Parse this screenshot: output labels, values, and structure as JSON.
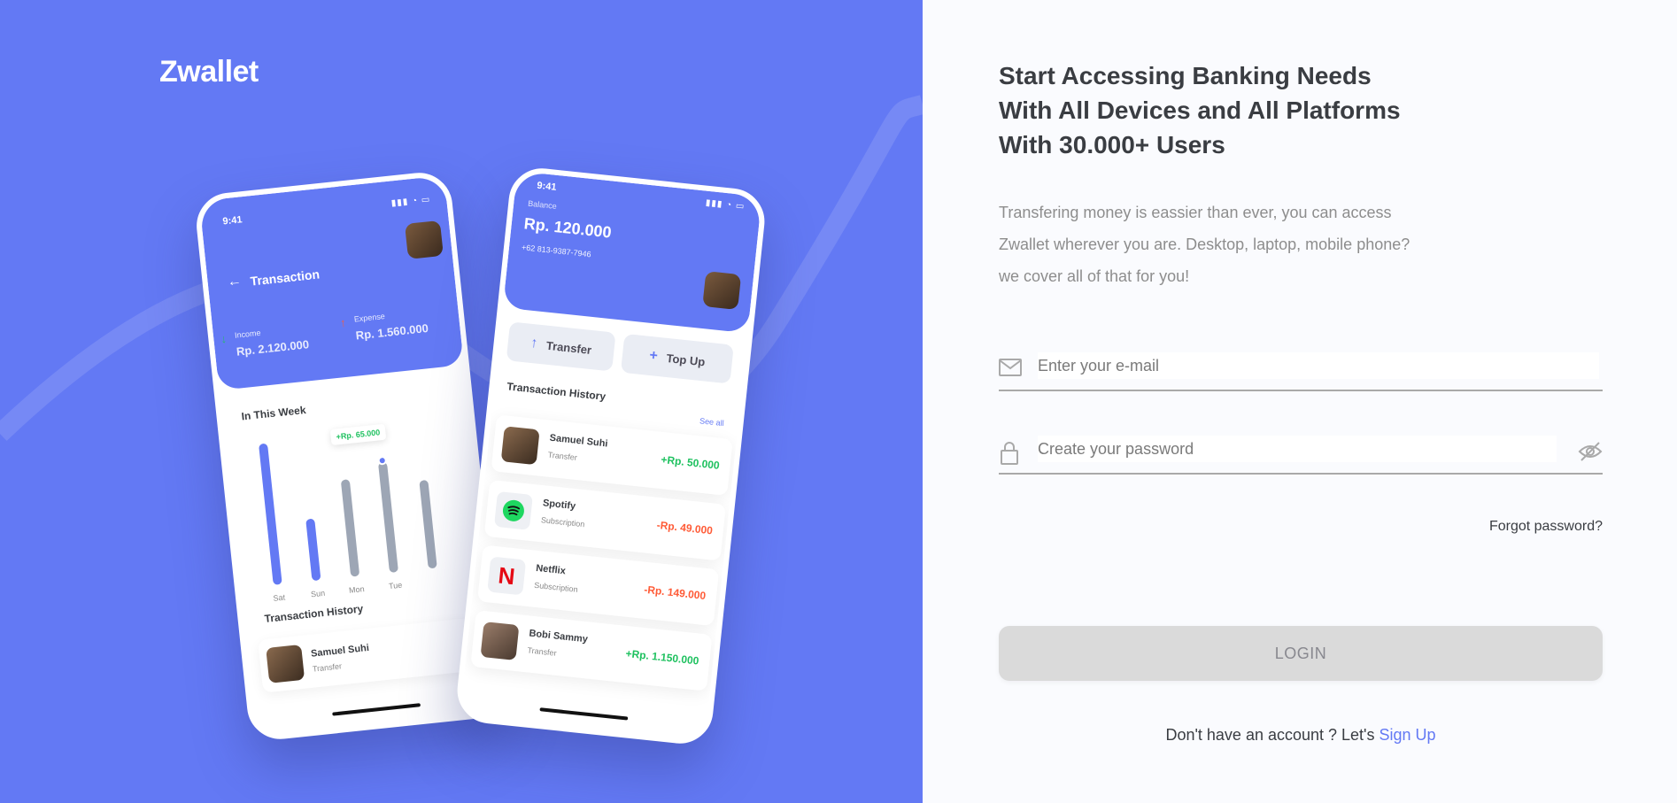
{
  "brand": {
    "name": "Zwallet"
  },
  "colors": {
    "primary": "#6379f4",
    "positive": "#1ec15f",
    "negative": "#ff5b37",
    "text": "#3a3d42"
  },
  "showcase": {
    "back_phone": {
      "time": "9:41",
      "title": "Transaction",
      "income_label": "Income",
      "income_value": "Rp. 2.120.000",
      "expense_label": "Expense",
      "expense_value": "Rp. 1.560.000",
      "week_title": "In This Week",
      "badge": "+Rp. 65.000",
      "days": [
        "Sat",
        "Sun",
        "Mon",
        "Tue"
      ],
      "history_title": "Transaction History",
      "row": {
        "name": "Samuel Suhi",
        "sub": "Transfer"
      }
    },
    "front_phone": {
      "time": "9:41",
      "balance_label": "Balance",
      "balance_value": "Rp. 120.000",
      "phone": "+62 813-9387-7946",
      "transfer_label": "Transfer",
      "topup_label": "Top Up",
      "history_title": "Transaction History",
      "see_all": "See all",
      "transactions": [
        {
          "name": "Samuel Suhi",
          "sub": "Transfer",
          "amount": "+Rp. 50.000"
        },
        {
          "name": "Spotify",
          "sub": "Subscription",
          "amount": "-Rp. 49.000"
        },
        {
          "name": "Netflix",
          "sub": "Subscription",
          "amount": "-Rp. 149.000"
        },
        {
          "name": "Bobi Sammy",
          "sub": "Transfer",
          "amount": "+Rp. 1.150.000"
        }
      ]
    }
  },
  "login": {
    "headline_1": "Start Accessing Banking Needs",
    "headline_2": "With All Devices and All Platforms",
    "headline_3": "With 30.000+ Users",
    "desc_1": "Transfering money is eassier than ever, you can access",
    "desc_2": "Zwallet wherever you are. Desktop, laptop, mobile phone?",
    "desc_3": "we cover all of that for you!",
    "email_placeholder": "Enter your e-mail",
    "password_placeholder": "Create your password",
    "forgot": "Forgot password?",
    "button": "LOGIN",
    "signup_prompt": "Don't have an account ? Let's",
    "signup_link": "Sign Up"
  }
}
